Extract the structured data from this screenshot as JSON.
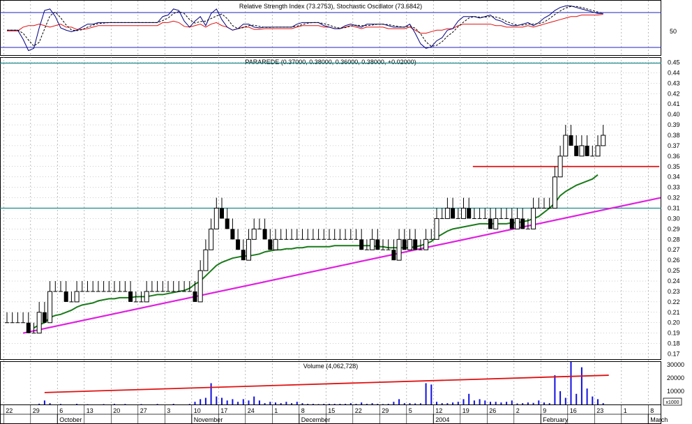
{
  "colors": {
    "price": "#000000",
    "ma": "#1a7a1a",
    "trend_support": "#e020e0",
    "resistance_teal": "#1a8a8a",
    "resistance_red": "#e01010",
    "volume": "#1010e0",
    "volume_trend": "#e01010",
    "rsi": "#e01010",
    "stoch_k": "#000080",
    "stoch_d": "#000000",
    "rsi_bands": "#2020c0",
    "grid": "#9a9a9a"
  },
  "chart_data": [
    {
      "type": "line",
      "title": "Relative Strength Index (73.2753), Stochastic Oscillator (73.6842)",
      "ytick": "50",
      "rsi_values": [
        51,
        51,
        51,
        56,
        58,
        58,
        60,
        58,
        56,
        58,
        60,
        56,
        56,
        53,
        53,
        54,
        56,
        58,
        58,
        58,
        58,
        58,
        58,
        58,
        58,
        58,
        58,
        58,
        58,
        62,
        62,
        64,
        62,
        57,
        56,
        58,
        60,
        56,
        60,
        62,
        58,
        56,
        52,
        54,
        56,
        56,
        53,
        53,
        54,
        54,
        54,
        54,
        54,
        54,
        56,
        58,
        58,
        58,
        58,
        56,
        56,
        54,
        54,
        56,
        58,
        56,
        54,
        56,
        56,
        56,
        56,
        54,
        54,
        54,
        54,
        56,
        52,
        48,
        48,
        50,
        52,
        52,
        54,
        54,
        58,
        60,
        60,
        60,
        60,
        60,
        60,
        58,
        58,
        56,
        56,
        56,
        56,
        58,
        56,
        58,
        60,
        62,
        64,
        66,
        68,
        70,
        70,
        72,
        72,
        72,
        72,
        73
      ],
      "stoch_values": [
        52,
        52,
        52,
        40,
        25,
        28,
        55,
        78,
        80,
        70,
        55,
        52,
        50,
        52,
        56,
        60,
        60,
        62,
        62,
        62,
        62,
        62,
        62,
        62,
        62,
        62,
        62,
        62,
        62,
        70,
        72,
        80,
        78,
        64,
        56,
        64,
        70,
        58,
        74,
        80,
        66,
        56,
        52,
        54,
        60,
        60,
        56,
        55,
        56,
        56,
        56,
        56,
        56,
        56,
        60,
        62,
        62,
        62,
        62,
        58,
        56,
        54,
        54,
        58,
        60,
        58,
        56,
        60,
        60,
        60,
        60,
        58,
        56,
        56,
        56,
        60,
        48,
        34,
        28,
        30,
        38,
        42,
        52,
        54,
        64,
        70,
        70,
        70,
        68,
        70,
        72,
        66,
        64,
        60,
        58,
        58,
        60,
        62,
        58,
        62,
        68,
        72,
        78,
        82,
        84,
        84,
        82,
        80,
        78,
        76,
        74,
        74
      ]
    },
    {
      "type": "bar",
      "title": "PARAREDE (0.37000, 0.38000, 0.36000, 0.38000, +0.02000)",
      "yticks": [
        "0.45",
        "0.44",
        "0.43",
        "0.42",
        "0.41",
        "0.40",
        "0.39",
        "0.38",
        "0.37",
        "0.36",
        "0.35",
        "0.34",
        "0.33",
        "0.32",
        "0.31",
        "0.30",
        "0.29",
        "0.28",
        "0.27",
        "0.26",
        "0.25",
        "0.24",
        "0.23",
        "0.22",
        "0.21",
        "0.20",
        "0.19",
        "0.18",
        "0.17"
      ],
      "ylim": [
        0.165,
        0.455
      ],
      "close_values": [
        0.2,
        0.2,
        0.2,
        0.2,
        0.19,
        0.19,
        0.21,
        0.2,
        0.23,
        0.23,
        0.23,
        0.22,
        0.22,
        0.23,
        0.23,
        0.23,
        0.23,
        0.23,
        0.23,
        0.23,
        0.23,
        0.23,
        0.23,
        0.22,
        0.22,
        0.22,
        0.23,
        0.23,
        0.23,
        0.23,
        0.23,
        0.23,
        0.23,
        0.23,
        0.23,
        0.22,
        0.25,
        0.27,
        0.29,
        0.31,
        0.3,
        0.29,
        0.28,
        0.27,
        0.26,
        0.28,
        0.29,
        0.29,
        0.28,
        0.27,
        0.28,
        0.28,
        0.28,
        0.28,
        0.28,
        0.28,
        0.28,
        0.28,
        0.28,
        0.28,
        0.28,
        0.28,
        0.28,
        0.28,
        0.28,
        0.28,
        0.27,
        0.27,
        0.28,
        0.27,
        0.27,
        0.27,
        0.26,
        0.28,
        0.27,
        0.28,
        0.27,
        0.27,
        0.28,
        0.28,
        0.3,
        0.3,
        0.31,
        0.3,
        0.3,
        0.31,
        0.3,
        0.3,
        0.3,
        0.3,
        0.29,
        0.3,
        0.3,
        0.3,
        0.29,
        0.3,
        0.29,
        0.29,
        0.31,
        0.31,
        0.31,
        0.31,
        0.34,
        0.36,
        0.38,
        0.37,
        0.36,
        0.37,
        0.36,
        0.36,
        0.37,
        0.38
      ],
      "ma_values": [
        null,
        null,
        null,
        null,
        null,
        0.195,
        0.198,
        0.2,
        0.205,
        0.207,
        0.208,
        0.21,
        0.212,
        0.215,
        0.217,
        0.218,
        0.219,
        0.221,
        0.222,
        0.223,
        0.223,
        0.224,
        0.224,
        0.224,
        0.225,
        0.225,
        0.225,
        0.226,
        0.227,
        0.227,
        0.228,
        0.229,
        0.23,
        0.231,
        0.233,
        0.237,
        0.24,
        0.245,
        0.25,
        0.255,
        0.258,
        0.26,
        0.262,
        0.263,
        0.264,
        0.264,
        0.265,
        0.266,
        0.268,
        0.269,
        0.27,
        0.27,
        0.271,
        0.271,
        0.272,
        0.272,
        0.273,
        0.273,
        0.273,
        0.273,
        0.273,
        0.274,
        0.274,
        0.274,
        0.274,
        0.274,
        0.274,
        0.274,
        0.274,
        0.273,
        0.273,
        0.272,
        0.272,
        0.272,
        0.272,
        0.272,
        0.273,
        0.274,
        0.276,
        0.278,
        0.282,
        0.285,
        0.288,
        0.29,
        0.291,
        0.292,
        0.293,
        0.294,
        0.295,
        0.295,
        0.295,
        0.295,
        0.295,
        0.295,
        0.296,
        0.296,
        0.297,
        0.298,
        0.3,
        0.302,
        0.306,
        0.31,
        0.315,
        0.322,
        0.326,
        0.329,
        0.332,
        0.334,
        0.336,
        0.338,
        0.342
      ],
      "support_trend": {
        "from": 0.19,
        "to": 0.318
      },
      "resistance_lines": [
        0.45,
        0.31
      ],
      "recent_resistance": 0.35
    },
    {
      "type": "bar",
      "title": "Volume (4,062,728)",
      "yticks": [
        "30000",
        "20000",
        "10000"
      ],
      "unit_label": "x1000",
      "ylim": [
        0,
        32000
      ],
      "values": [
        0,
        0,
        0,
        0,
        0,
        0,
        600,
        3000,
        1000,
        0,
        400,
        0,
        0,
        500,
        0,
        200,
        0,
        0,
        300,
        0,
        500,
        0,
        400,
        0,
        0,
        300,
        0,
        0,
        400,
        0,
        0,
        500,
        0,
        0,
        400,
        2000,
        4000,
        5000,
        16000,
        6000,
        5000,
        3000,
        4000,
        2000,
        4000,
        3000,
        6000,
        3000,
        1000,
        2000,
        1500,
        1000,
        2000,
        1000,
        2000,
        1000,
        500,
        500,
        300,
        500,
        500,
        500,
        500,
        500,
        1000,
        500,
        1500,
        500,
        1000,
        500,
        300,
        500,
        2000,
        4000,
        1000,
        1000,
        800,
        900,
        16000,
        15000,
        2000,
        1000,
        1000,
        1500,
        2000,
        4000,
        8000,
        3000,
        4000,
        3000,
        2000,
        2000,
        1500,
        2000,
        3000,
        800,
        1000,
        1500,
        1200,
        3000,
        1500,
        1000,
        22000,
        10000,
        5000,
        32000,
        8000,
        28000,
        12000,
        6000,
        4000,
        1000
      ],
      "trend": {
        "from": 9000,
        "to": 22000
      }
    }
  ],
  "x_axis": {
    "day_ticks": [
      "22",
      "29",
      "6",
      "13",
      "20",
      "27",
      "3",
      "10",
      "17",
      "24",
      "1",
      "8",
      "15",
      "22",
      "29",
      "5",
      "12",
      "19",
      "26",
      "2",
      "9",
      "16",
      "23",
      "1",
      "8"
    ],
    "month_labels": [
      "October",
      "November",
      "December",
      "2004",
      "February",
      "March"
    ]
  }
}
